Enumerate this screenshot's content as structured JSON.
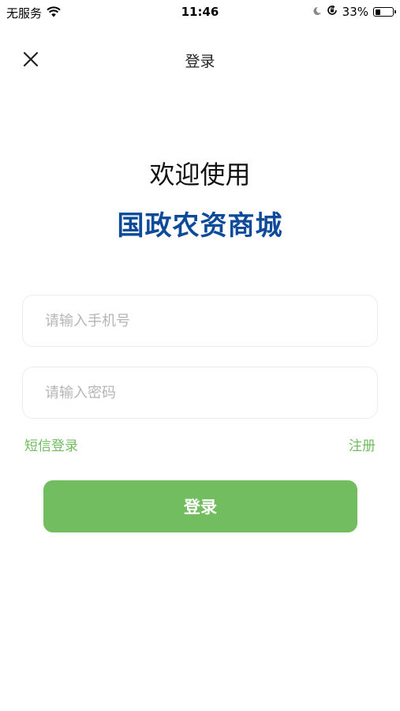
{
  "status_bar": {
    "carrier": "无服务",
    "time": "11:46",
    "battery_percent_text": "33%",
    "battery_level": 0.33,
    "icons": [
      "wifi-icon",
      "moon-icon",
      "orientation-lock-icon",
      "battery-icon"
    ]
  },
  "nav": {
    "title": "登录",
    "close_icon": "close-icon"
  },
  "welcome": {
    "line1": "欢迎使用",
    "brand": "国政农资商城"
  },
  "form": {
    "phone_placeholder": "请输入手机号",
    "phone_value": "",
    "password_placeholder": "请输入密码",
    "password_value": "",
    "sms_login_label": "短信登录",
    "register_label": "注册",
    "login_button_label": "登录"
  },
  "colors": {
    "brand": "#0d4a9a",
    "accent": "#72bd5f",
    "link": "#6fbb5e"
  }
}
